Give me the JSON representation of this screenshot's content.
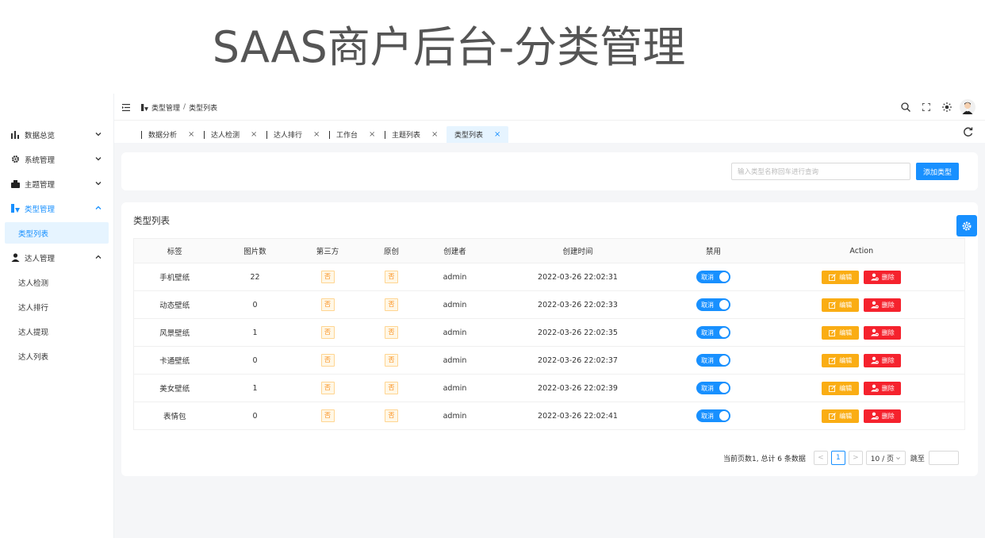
{
  "banner": {
    "title": "SAAS商户后台-分类管理"
  },
  "breadcrumb": {
    "parent": "类型管理",
    "separator": "/",
    "current": "类型列表"
  },
  "sidebar": {
    "items": [
      {
        "label": "数据总览",
        "icon": "bar-chart-icon"
      },
      {
        "label": "系统管理",
        "icon": "gear-icon"
      },
      {
        "label": "主题管理",
        "icon": "box-icon"
      },
      {
        "label": "类型管理",
        "icon": "type-icon"
      },
      {
        "label": "达人管理",
        "icon": "user-icon"
      }
    ],
    "type_sub": [
      {
        "label": "类型列表"
      }
    ],
    "talent_sub": [
      {
        "label": "达人检测"
      },
      {
        "label": "达人排行"
      },
      {
        "label": "达人提现"
      },
      {
        "label": "达人列表"
      }
    ]
  },
  "tabs": [
    {
      "label": "数据分析"
    },
    {
      "label": "达人检测"
    },
    {
      "label": "达人排行"
    },
    {
      "label": "工作台"
    },
    {
      "label": "主题列表"
    },
    {
      "label": "类型列表"
    }
  ],
  "search": {
    "placeholder": "输入类型名称回车进行查询",
    "add_label": "添加类型"
  },
  "list": {
    "title": "类型列表",
    "columns": [
      "标签",
      "图片数",
      "第三方",
      "原创",
      "创建者",
      "创建时间",
      "禁用",
      "Action"
    ],
    "rows": [
      {
        "label": "手机壁纸",
        "count": "22",
        "third": "否",
        "original": "否",
        "creator": "admin",
        "created": "2022-03-26 22:02:31",
        "disabled": "取消"
      },
      {
        "label": "动态壁纸",
        "count": "0",
        "third": "否",
        "original": "否",
        "creator": "admin",
        "created": "2022-03-26 22:02:33",
        "disabled": "取消"
      },
      {
        "label": "风景壁纸",
        "count": "1",
        "third": "否",
        "original": "否",
        "creator": "admin",
        "created": "2022-03-26 22:02:35",
        "disabled": "取消"
      },
      {
        "label": "卡通壁纸",
        "count": "0",
        "third": "否",
        "original": "否",
        "creator": "admin",
        "created": "2022-03-26 22:02:37",
        "disabled": "取消"
      },
      {
        "label": "美女壁纸",
        "count": "1",
        "third": "否",
        "original": "否",
        "creator": "admin",
        "created": "2022-03-26 22:02:39",
        "disabled": "取消"
      },
      {
        "label": "表情包",
        "count": "0",
        "third": "否",
        "original": "否",
        "creator": "admin",
        "created": "2022-03-26 22:02:41",
        "disabled": "取消"
      }
    ],
    "edit_label": "编辑",
    "delete_label": "删除"
  },
  "pager": {
    "summary": "当前页数1, 总计 6 条数据",
    "prev": "<",
    "current": "1",
    "next": ">",
    "size": "10 / 页",
    "jump_label": "跳至"
  },
  "colors": {
    "primary": "#1890ff",
    "edit": "#faad14",
    "delete": "#f5222d"
  }
}
